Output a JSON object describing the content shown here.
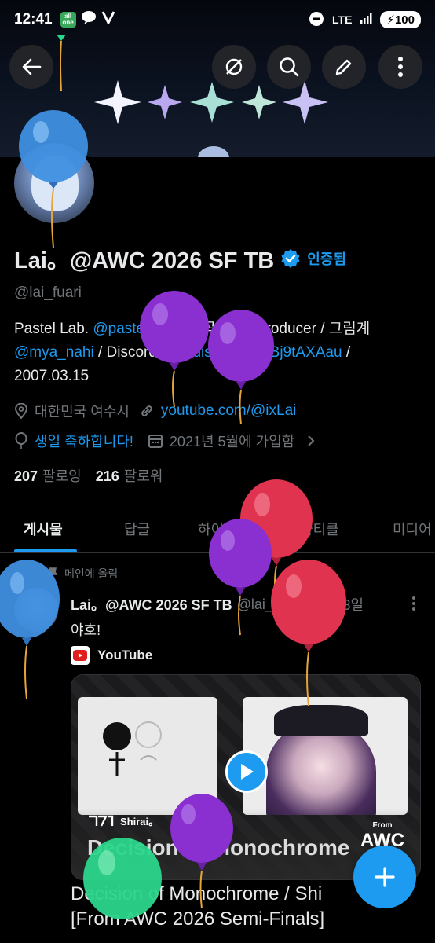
{
  "status_bar": {
    "time": "12:41",
    "app_badge": "all one",
    "network": "LTE",
    "battery": "100"
  },
  "icons": {
    "back": "back-arrow-icon",
    "no_filter": "no-filter-icon",
    "search": "search-icon",
    "edit": "edit-pencil-icon",
    "more": "more-vertical-icon",
    "location": "location-pin-icon",
    "link": "link-icon",
    "birthday": "balloon-icon",
    "calendar": "calendar-icon",
    "chevron": "chevron-right-icon",
    "pin": "pin-icon",
    "play": "play-icon",
    "compose": "plus-icon"
  },
  "profile": {
    "display_name": "Lai。@AWC 2026 SF TB",
    "verified_label": "인증됨",
    "handle": "@lai_fuari",
    "bio_1_pre": "Pastel Lab. ",
    "bio_1_link": "@pastel_lab",
    "bio_1_post": " / 작곡해요 / Producer / 그림계",
    "bio_2_link": "@mya_nahi",
    "bio_2_mid": " /  Discord 서버 ",
    "bio_2_link2": "discord.gg/fBj9tAXAau",
    "bio_2_post": " /",
    "bio_3": "2007.03.15",
    "location": "대한민국 여수시",
    "website": "youtube.com/@ixLai",
    "birthday": "생일 축하합니다!",
    "joined": "2021년 5월에 가입함",
    "following_count": "207",
    "following_label": "팔로잉",
    "followers_count": "216",
    "followers_label": "팔로워"
  },
  "tabs": [
    {
      "label": "게시물"
    },
    {
      "label": "답글"
    },
    {
      "label": "하이라이트"
    },
    {
      "label": "아티클"
    },
    {
      "label": "미디어"
    }
  ],
  "tweet": {
    "pinned_label": "메인에 올림",
    "author_name": "Lai。@AWC 2026 SF TB",
    "author_handle": "@lai_f...",
    "date": "· 02월 13일",
    "text": "야호!",
    "source": "YouTube",
    "card_brand": "Shirai。",
    "card_title_overlay": "Decision of Monochrome",
    "card_from": "From",
    "card_from_logo": "AWC",
    "caption_1": "Decision of Monochrome / Shi",
    "caption_2": "[From AWC 2026 Semi-Finals]"
  },
  "colors": {
    "accent": "#1d9bf0",
    "background": "#000000",
    "muted_text": "#71767b",
    "balloon_blue": "#3f8fe0",
    "balloon_purple": "#8a2fd0",
    "balloon_red": "#e0334f",
    "balloon_green": "#2bd58a"
  }
}
